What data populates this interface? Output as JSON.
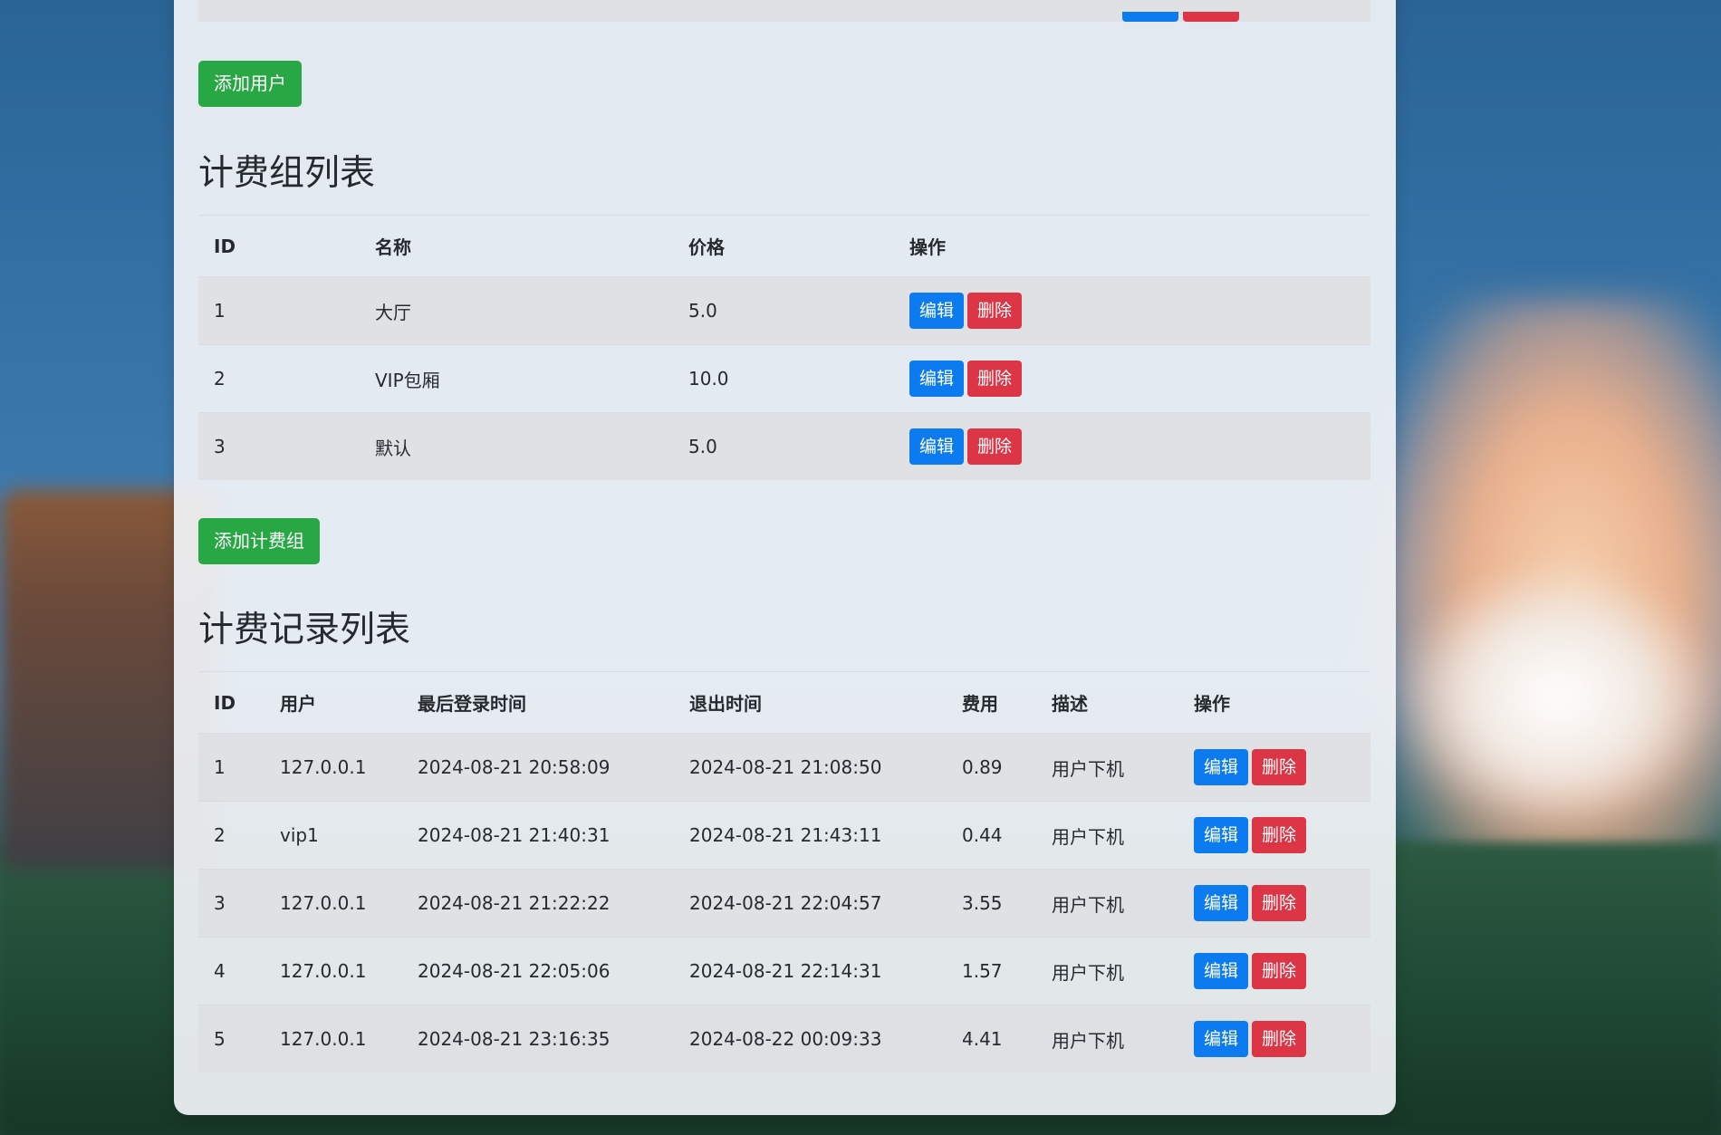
{
  "colors": {
    "success": "#28a745",
    "primary": "#0d7bf0",
    "danger": "#dc3545"
  },
  "add_user_button": "添加用户",
  "billing_groups": {
    "title": "计费组列表",
    "headers": [
      "ID",
      "名称",
      "价格",
      "操作"
    ],
    "rows": [
      {
        "id": "1",
        "name": "大厅",
        "price": "5.0"
      },
      {
        "id": "2",
        "name": "VIP包厢",
        "price": "10.0"
      },
      {
        "id": "3",
        "name": "默认",
        "price": "5.0"
      }
    ],
    "edit_label": "编辑",
    "delete_label": "删除",
    "add_button": "添加计费组"
  },
  "billing_records": {
    "title": "计费记录列表",
    "headers": [
      "ID",
      "用户",
      "最后登录时间",
      "退出时间",
      "费用",
      "描述",
      "操作"
    ],
    "rows": [
      {
        "id": "1",
        "user": "127.0.0.1",
        "login": "2024-08-21 20:58:09",
        "logout": "2024-08-21 21:08:50",
        "fee": "0.89",
        "desc": "用户下机"
      },
      {
        "id": "2",
        "user": "vip1",
        "login": "2024-08-21 21:40:31",
        "logout": "2024-08-21 21:43:11",
        "fee": "0.44",
        "desc": "用户下机"
      },
      {
        "id": "3",
        "user": "127.0.0.1",
        "login": "2024-08-21 21:22:22",
        "logout": "2024-08-21 22:04:57",
        "fee": "3.55",
        "desc": "用户下机"
      },
      {
        "id": "4",
        "user": "127.0.0.1",
        "login": "2024-08-21 22:05:06",
        "logout": "2024-08-21 22:14:31",
        "fee": "1.57",
        "desc": "用户下机"
      },
      {
        "id": "5",
        "user": "127.0.0.1",
        "login": "2024-08-21 23:16:35",
        "logout": "2024-08-22 00:09:33",
        "fee": "4.41",
        "desc": "用户下机"
      }
    ],
    "edit_label": "编辑",
    "delete_label": "删除"
  }
}
